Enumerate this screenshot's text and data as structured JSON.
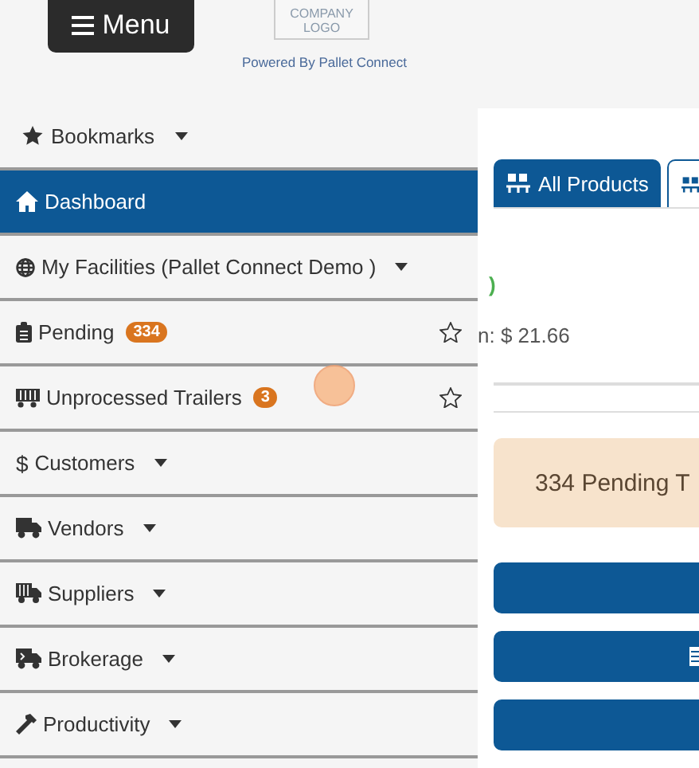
{
  "header": {
    "menu_button": "Menu",
    "logo_text": "COMPANY LOGO",
    "powered_by": "Powered By Pallet Connect"
  },
  "bookmarks": {
    "label": "Bookmarks"
  },
  "sidebar": {
    "items": [
      {
        "label": "Dashboard",
        "selected": true,
        "dropdown": false
      },
      {
        "label": "My Facilities (Pallet Connect Demo )",
        "selected": false,
        "dropdown": true
      },
      {
        "label": "Pending",
        "selected": false,
        "dropdown": false,
        "badge": "334",
        "starred": false
      },
      {
        "label": "Unprocessed Trailers",
        "selected": false,
        "dropdown": false,
        "badge": "3",
        "starred": false
      },
      {
        "label": "Customers",
        "selected": false,
        "dropdown": true,
        "symbol": "$"
      },
      {
        "label": "Vendors",
        "selected": false,
        "dropdown": true
      },
      {
        "label": "Suppliers",
        "selected": false,
        "dropdown": true
      },
      {
        "label": "Brokerage",
        "selected": false,
        "dropdown": true
      },
      {
        "label": "Productivity",
        "selected": false,
        "dropdown": true
      }
    ]
  },
  "main": {
    "tabs": [
      {
        "label": "All Products",
        "selected": true
      },
      {
        "selected": false
      }
    ],
    "summary_fragment": ")",
    "price_fragment": "n: $ 21.66",
    "alert": "334 Pending T",
    "action_buttons": [
      {
        "kind": "plain"
      },
      {
        "kind": "icon"
      },
      {
        "kind": "plain"
      }
    ]
  }
}
